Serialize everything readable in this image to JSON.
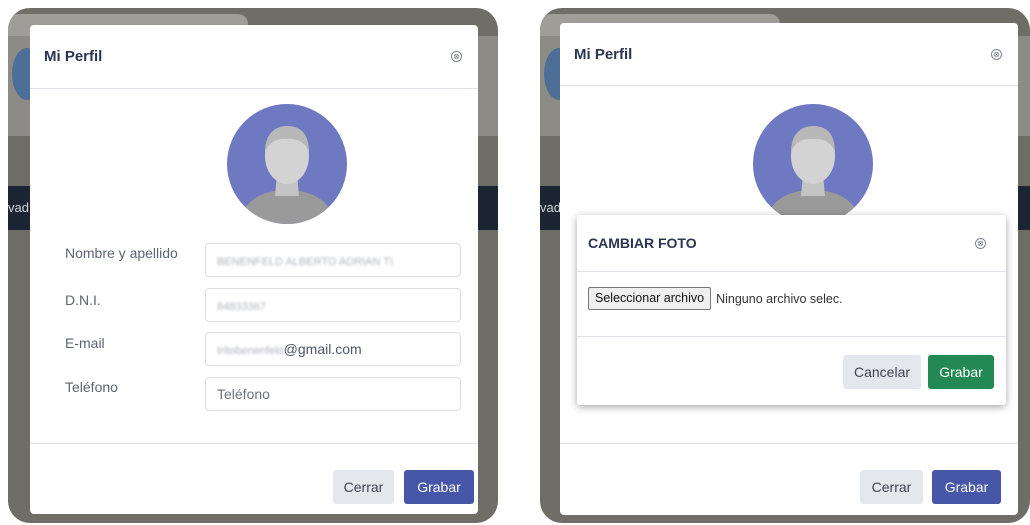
{
  "left": {
    "background_strip_text": "vad",
    "modal": {
      "title": "Mi Perfil",
      "close_glyph": "⊗",
      "fields": [
        {
          "label": "Nombre y apellido",
          "value": "BENENFELD ALBERTO ADRIAN TI"
        },
        {
          "label": "D.N.I.",
          "value": "84833367"
        },
        {
          "label": "E-mail",
          "value_blurred": "tritobenenfeld",
          "value_visible": "@gmail.com"
        },
        {
          "label": "Teléfono",
          "placeholder": "Teléfono"
        }
      ],
      "close_button": "Cerrar",
      "save_button": "Grabar"
    }
  },
  "right": {
    "background_strip_text": "vad",
    "modal": {
      "title": "Mi Perfil",
      "close_glyph": "⊗",
      "close_button": "Cerrar",
      "save_button": "Grabar"
    },
    "change_photo_dialog": {
      "title": "CAMBIAR FOTO",
      "close_glyph": "⊗",
      "file_button": "Seleccionar archivo",
      "file_status": "Ninguno archivo selec.",
      "cancel_button": "Cancelar",
      "save_button": "Grabar"
    }
  },
  "icons": {
    "avatar": "default-user-silhouette-icon",
    "close": "circle-x-icon"
  },
  "colors": {
    "title": "#2b3553",
    "avatar_bg": "#6e79c2",
    "primary": "#4757a8",
    "success": "#228954",
    "frame": "#6f6e66",
    "strip": "#1b2534"
  }
}
